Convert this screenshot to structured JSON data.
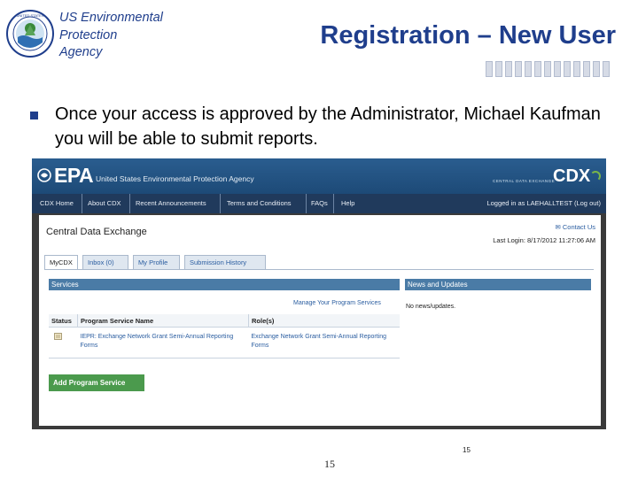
{
  "slide": {
    "agency_name": "US Environmental\nProtection\nAgency",
    "title": "Registration – New User",
    "bullet": "Once your access is approved by the Administrator, Michael Kaufman you will be able to submit reports.",
    "page_number": "15",
    "screenshot_page_number": "15",
    "colors": {
      "title": "#1f3e8c",
      "bullet": "#1f3e8c"
    }
  },
  "cdx": {
    "banner": {
      "logo": "EPA",
      "agency": "United States Environmental Protection Agency",
      "cdx_small": "CENTRAL DATA EXCHANGE",
      "cdx_big": "CDX"
    },
    "nav": {
      "items": [
        "CDX Home",
        "About CDX",
        "Recent Announcements",
        "Terms and Conditions",
        "FAQs",
        "Help"
      ],
      "login": "Logged in as LAEHALLTEST (Log out)"
    },
    "page_title": "Central Data Exchange",
    "contact": "Contact Us",
    "last_login": "Last Login: 8/17/2012 11:27:06 AM",
    "tabs": [
      "MyCDX",
      "Inbox (0)",
      "My Profile",
      "Submission History"
    ],
    "services": {
      "heading": "Services",
      "manage_link": "Manage Your Program Services",
      "columns": [
        "Status",
        "Program Service Name",
        "Role(s)"
      ],
      "rows": [
        {
          "status_icon": "document-status-icon",
          "name": "IEPR: Exchange Network Grant Semi-Annual Reporting Forms",
          "role": "Exchange Network Grant Semi-Annual Reporting Forms"
        }
      ],
      "add_button": "Add Program Service"
    },
    "news": {
      "heading": "News and Updates",
      "text": "No news/updates."
    },
    "colors": {
      "banner": "#2a5d8f",
      "nav": "#203a5c",
      "panel_header": "#4a7ba6",
      "add_button": "#4b9a4d",
      "link": "#2a5da0"
    }
  }
}
